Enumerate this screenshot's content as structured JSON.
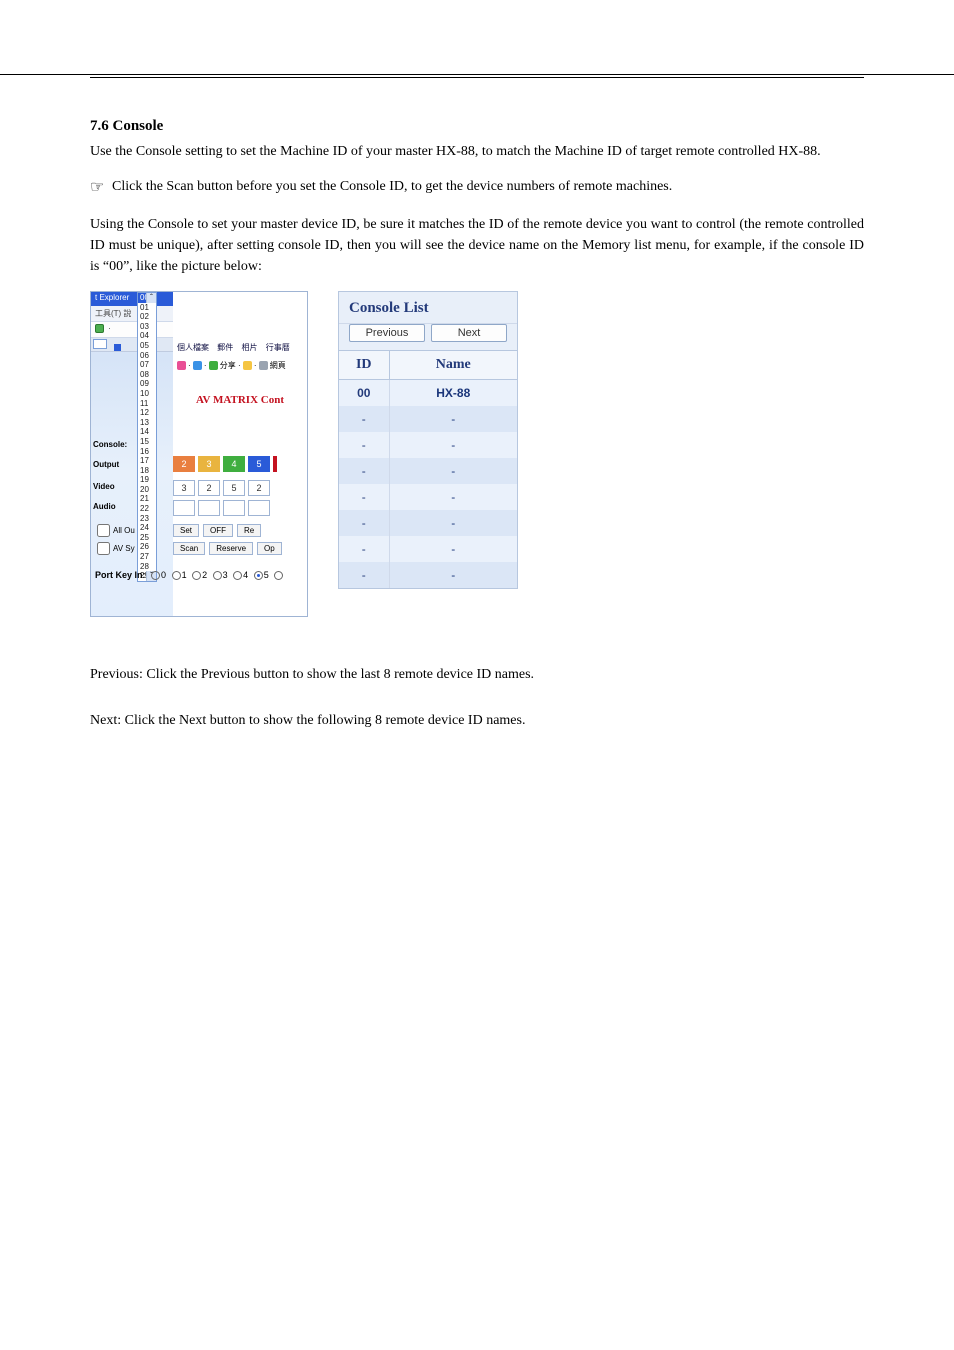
{
  "header": {
    "left": "",
    "center": "",
    "right": ""
  },
  "section": {
    "title": "7.6 Console",
    "p1": "Use the Console setting to set the Machine ID of your master HX-88, to match the Machine ID of target remote controlled HX-88.",
    "note_icon": "☞",
    "note_text": "Click the Scan button before you set the Console ID, to get the device numbers of remote machines.",
    "p2": "Using the Console to set your master device ID, be sure it matches the ID of the remote device you want to control (the remote controlled ID must be unique), after setting console ID, then you will see the device name on the Memory list menu, for example, if the console ID is",
    "p2_q": "00",
    "p2_tail": ", like the picture below:"
  },
  "left": {
    "titlebar": "t Explorer",
    "menu1": "工具(T)   說",
    "dropdown": [
      "00",
      "01",
      "02",
      "03",
      "04",
      "05",
      "06",
      "07",
      "08",
      "09",
      "10",
      "11",
      "12",
      "13",
      "14",
      "15",
      "16",
      "17",
      "18",
      "19",
      "20",
      "21",
      "22",
      "23",
      "24",
      "25",
      "26",
      "27",
      "28",
      "29"
    ],
    "dropdown_selected": "00",
    "scroll_up": "ˆ",
    "scroll_dn": "ˇ",
    "breadcrumb": [
      "個人檔案",
      "郵件",
      "相片",
      "行事曆"
    ],
    "ico_share": "分享",
    "ico_web": "網頁",
    "heading": "AV MATRIX Cont",
    "labels": {
      "console": "Console:",
      "output": "Output",
      "video": "Video",
      "audio": "Audio"
    },
    "outputs": [
      {
        "n": "2",
        "c": "o2"
      },
      {
        "n": "3",
        "c": "o3"
      },
      {
        "n": "4",
        "c": "o4"
      },
      {
        "n": "5",
        "c": "o5"
      }
    ],
    "inputs": [
      "3",
      "2",
      "5",
      "2"
    ],
    "chk1": "All Ou",
    "chk2": "AV Sy",
    "btns1": [
      "Set",
      "OFF",
      "Re"
    ],
    "btns2": [
      "Scan",
      "Reserve",
      "Op"
    ],
    "portkey_label": "Port Key In:",
    "portkeys": [
      "0",
      "1",
      "2",
      "3",
      "4",
      "5"
    ],
    "portkey_selected": "5"
  },
  "right": {
    "title": "Console List",
    "prev": "Previous",
    "next": "Next",
    "id_h": "ID",
    "name_h": "Name",
    "rows": [
      {
        "id": "00",
        "name": "HX-88"
      },
      {
        "id": "-",
        "name": "-"
      },
      {
        "id": "-",
        "name": "-"
      },
      {
        "id": "-",
        "name": "-"
      },
      {
        "id": "-",
        "name": "-"
      },
      {
        "id": "-",
        "name": "-"
      },
      {
        "id": "-",
        "name": "-"
      },
      {
        "id": "-",
        "name": "-"
      }
    ]
  },
  "pn": {
    "p1": "Previous: Click the Previous button to show the last 8 remote device ID names.",
    "p2": "Next: Click the Next button to show the following 8 remote device ID names."
  },
  "chart_data": null
}
